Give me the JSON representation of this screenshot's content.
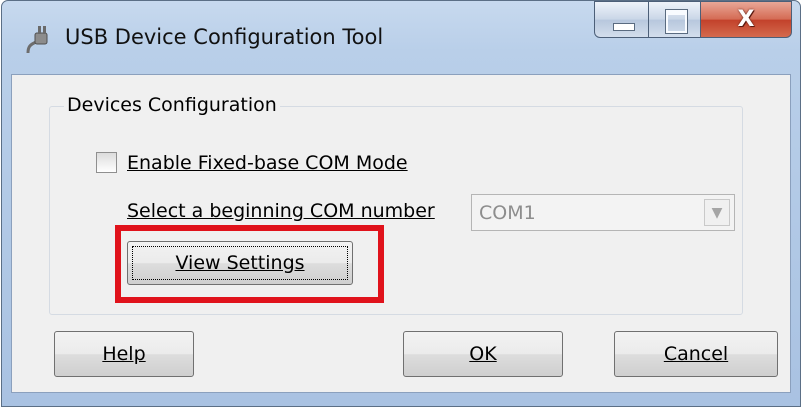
{
  "window": {
    "title": "USB Device Configuration Tool",
    "icon": "usb-plug-icon",
    "controls": {
      "minimize": "minimize-icon",
      "maximize": "maximize-icon",
      "close": "close-icon",
      "close_glyph": "X"
    }
  },
  "devices_group": {
    "title": "Devices Configuration",
    "fixed_base_checkbox": {
      "label": "Enable Fixed-base COM Mode",
      "checked": false
    },
    "com_number": {
      "label": "Select a beginning COM number",
      "value": "COM1",
      "enabled": false
    },
    "view_settings_button": "View Settings"
  },
  "buttons": {
    "help": "Help",
    "ok": "OK",
    "cancel": "Cancel"
  },
  "highlight_color": "#e0121b"
}
